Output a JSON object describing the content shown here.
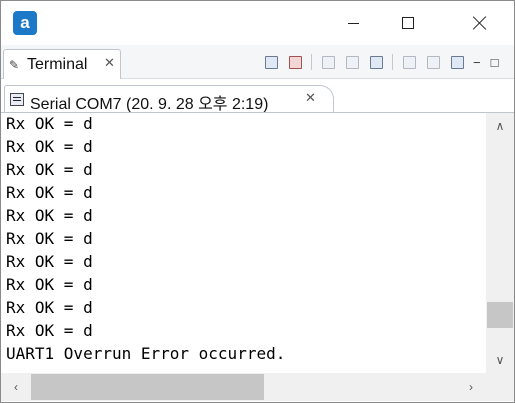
{
  "window": {
    "app_icon_letter": "a"
  },
  "view_tab": {
    "label": "Terminal",
    "close": "✕"
  },
  "editor_tab": {
    "label": "Serial COM7 (20. 9. 28 오후 2:19)",
    "close": "✕"
  },
  "toolbar": {
    "icons": [
      "connect-icon",
      "disconnect-icon",
      "settings-icon",
      "clear-icon",
      "scroll-lock-icon",
      "copy-icon",
      "paste-icon",
      "command-input-icon"
    ],
    "minimize_symbol": "−",
    "maximize_symbol": "□"
  },
  "terminal": {
    "lines": [
      "Rx OK = d",
      "Rx OK = d",
      "Rx OK = d",
      "Rx OK = d",
      "Rx OK = d",
      "Rx OK = d",
      "Rx OK = d",
      "Rx OK = d",
      "Rx OK = d",
      "Rx OK = d",
      "UART1 Overrun Error occurred."
    ]
  },
  "scrollbars": {
    "up_arrow": "∧",
    "down_arrow": "∨",
    "left_arrow": "‹",
    "right_arrow": "›"
  }
}
